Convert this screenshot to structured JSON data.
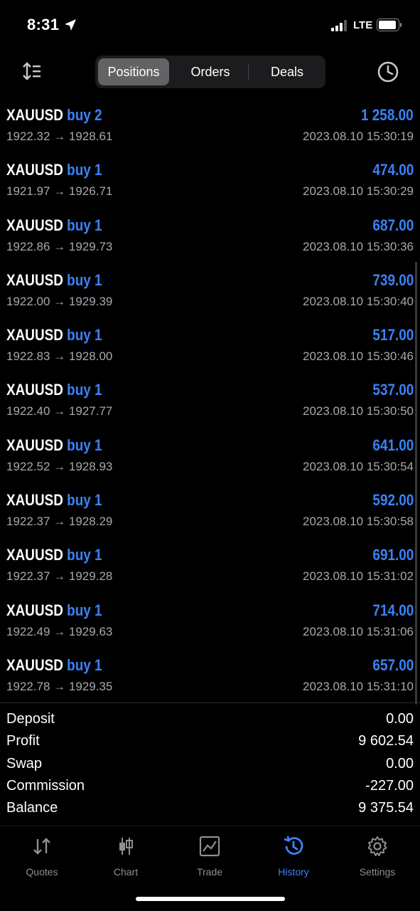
{
  "status": {
    "time": "8:31",
    "network": "LTE"
  },
  "tabs": {
    "positions": "Positions",
    "orders": "Orders",
    "deals": "Deals"
  },
  "deals": [
    {
      "symbol": "XAUUSD",
      "type": "buy 2",
      "prices": "1922.32 → 1928.61",
      "profit": "1 258.00",
      "time": "2023.08.10 15:30:19"
    },
    {
      "symbol": "XAUUSD",
      "type": "buy 1",
      "prices": "1921.97 → 1926.71",
      "profit": "474.00",
      "time": "2023.08.10 15:30:29"
    },
    {
      "symbol": "XAUUSD",
      "type": "buy 1",
      "prices": "1922.86 → 1929.73",
      "profit": "687.00",
      "time": "2023.08.10 15:30:36"
    },
    {
      "symbol": "XAUUSD",
      "type": "buy 1",
      "prices": "1922.00 → 1929.39",
      "profit": "739.00",
      "time": "2023.08.10 15:30:40"
    },
    {
      "symbol": "XAUUSD",
      "type": "buy 1",
      "prices": "1922.83 → 1928.00",
      "profit": "517.00",
      "time": "2023.08.10 15:30:46"
    },
    {
      "symbol": "XAUUSD",
      "type": "buy 1",
      "prices": "1922.40 → 1927.77",
      "profit": "537.00",
      "time": "2023.08.10 15:30:50"
    },
    {
      "symbol": "XAUUSD",
      "type": "buy 1",
      "prices": "1922.52 → 1928.93",
      "profit": "641.00",
      "time": "2023.08.10 15:30:54"
    },
    {
      "symbol": "XAUUSD",
      "type": "buy 1",
      "prices": "1922.37 → 1928.29",
      "profit": "592.00",
      "time": "2023.08.10 15:30:58"
    },
    {
      "symbol": "XAUUSD",
      "type": "buy 1",
      "prices": "1922.37 → 1929.28",
      "profit": "691.00",
      "time": "2023.08.10 15:31:02"
    },
    {
      "symbol": "XAUUSD",
      "type": "buy 1",
      "prices": "1922.49 → 1929.63",
      "profit": "714.00",
      "time": "2023.08.10 15:31:06"
    },
    {
      "symbol": "XAUUSD",
      "type": "buy 1",
      "prices": "1922.78 → 1929.35",
      "profit": "657.00",
      "time": "2023.08.10 15:31:10"
    }
  ],
  "summary": {
    "deposit": {
      "label": "Deposit",
      "value": "0.00"
    },
    "profit": {
      "label": "Profit",
      "value": "9 602.54"
    },
    "swap": {
      "label": "Swap",
      "value": "0.00"
    },
    "commission": {
      "label": "Commission",
      "value": "-227.00"
    },
    "balance": {
      "label": "Balance",
      "value": "9 375.54"
    }
  },
  "nav": {
    "quotes": "Quotes",
    "chart": "Chart",
    "trade": "Trade",
    "history": "History",
    "settings": "Settings"
  },
  "colors": {
    "accent": "#3b82f6",
    "background": "#000000",
    "muted": "#a8a8ae"
  }
}
